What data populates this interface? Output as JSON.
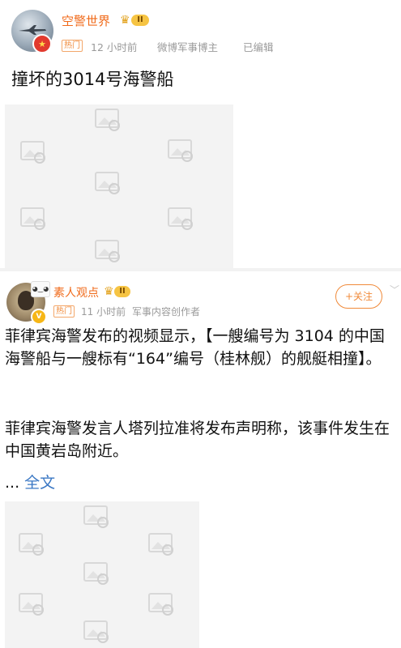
{
  "post1": {
    "author": "空警世界",
    "level": "II",
    "hot_tag": "热门",
    "time": "12 小时前",
    "source": "微博军事博主",
    "edited": "已编辑",
    "title": "撞坏的3014号海警船"
  },
  "post2": {
    "author": "素人观点",
    "level": "II",
    "hot_tag": "热门",
    "time": "11 小时前",
    "source": "军事内容创作者",
    "follow": "+关注",
    "paragraph1": "菲律宾海警发布的视频显示，【一艘编号为 3104 的中国海警船与一艘标有“164”编号（桂林舰）的舰艇相撞】。",
    "paragraph2": "菲律宾海警发言人塔列拉准将发布声明称，该事件发生在中国黄岩岛附近。",
    "ellipsis": "...",
    "more": "全文"
  },
  "icons": {
    "crown": "crown-icon",
    "verified": "verified-v-icon",
    "placeholder": "image-placeholder-icon",
    "chevron": "chevron-down-icon"
  },
  "colors": {
    "username": "#f06a1a",
    "link": "#3b78c4",
    "meta": "#9a9a9a",
    "placeholder_bg": "#f3f3f3"
  }
}
